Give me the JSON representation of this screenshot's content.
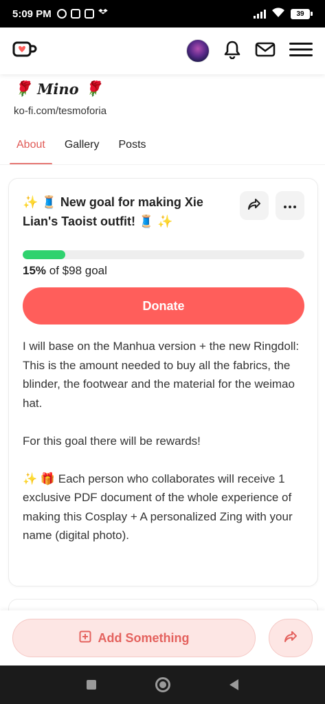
{
  "status_bar": {
    "time": "5:09 PM",
    "battery": "39"
  },
  "header": {
    "logo_icon": "kofi-cup-icon",
    "icons": [
      "avatar",
      "bell-icon",
      "mail-icon",
      "menu-icon"
    ]
  },
  "profile": {
    "name_prefix_emoji": "🌹",
    "name": "Mino",
    "name_suffix_emoji": "🌹",
    "url": "ko-fi.com/tesmoforia"
  },
  "tabs": [
    {
      "label": "About",
      "active": true
    },
    {
      "label": "Gallery",
      "active": false
    },
    {
      "label": "Posts",
      "active": false
    }
  ],
  "goal": {
    "title": "✨ 🧵 New goal for making Xie Lian's Taoist outfit! 🧵 ✨",
    "progress_percent": 15,
    "percent_label": "15%",
    "goal_suffix": " of $98 goal",
    "donate_label": "Donate",
    "description": [
      "I will base on the Manhua version + the new Ringdoll: This is the amount needed to buy all the fabrics, the blinder, the footwear and the material for the weimao hat.",
      "For this goal there will be rewards!",
      "✨ 🎁 Each person who collaborates will receive 1 exclusive PDF document of the whole experience of making this Cosplay + A personalized Zing with your name (digital photo)."
    ]
  },
  "bottom_bar": {
    "add_label": "Add Something"
  },
  "colors": {
    "accent": "#ff5e5b",
    "accent_light": "#fde6e4",
    "progress": "#2fd26e",
    "tab_active": "#e05a56"
  }
}
